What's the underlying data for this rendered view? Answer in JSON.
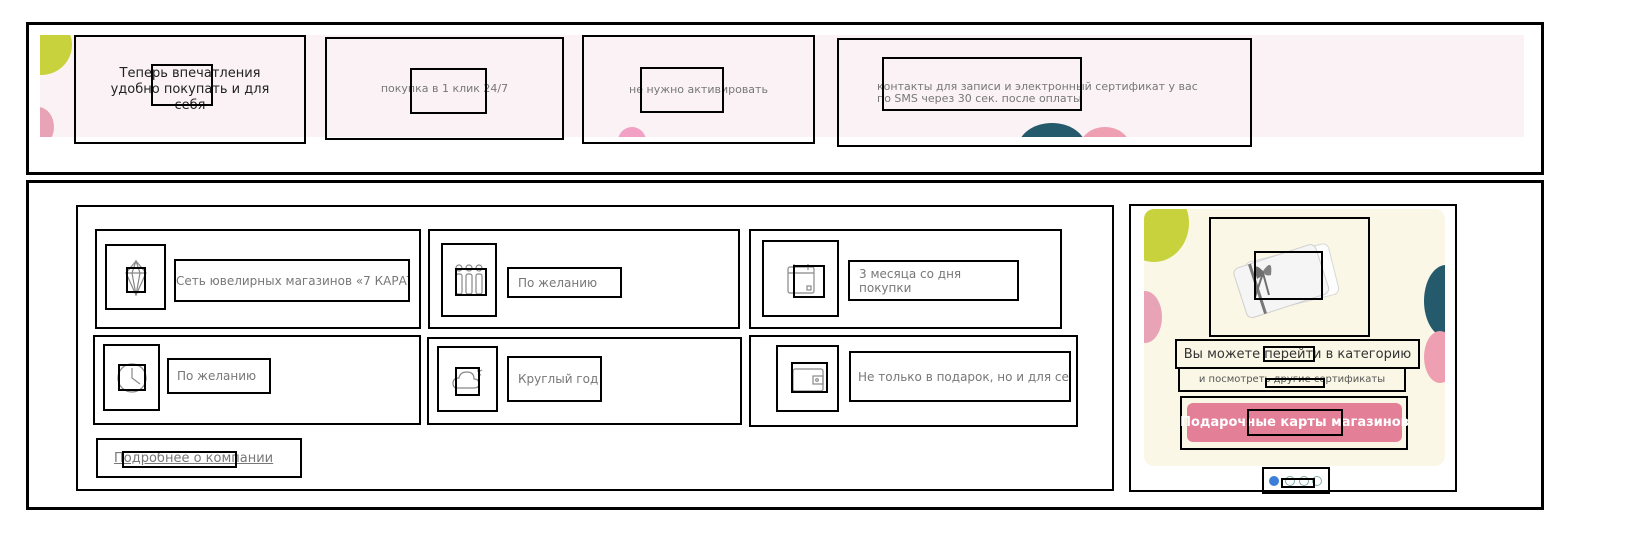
{
  "banner": {
    "title": "Теперь впечатления удобно покупать и для себя",
    "feature_1": "покупка в 1 клик 24/7",
    "feature_2": "не нужно активировать",
    "feature_3": "контакты для записи и электронный сертификат у вас по SMS через 30 сек. после оплаты"
  },
  "info": {
    "items": [
      {
        "icon": "diamond-ring-icon",
        "label": "Сеть ювелирных магазинов «7 КАРАТ»"
      },
      {
        "icon": "nominal-values-icon",
        "label": "По желанию"
      },
      {
        "icon": "calendar-icon",
        "label": "3 месяца со дня покупки"
      },
      {
        "icon": "clock-icon",
        "label": "По желанию"
      },
      {
        "icon": "weather-season-icon",
        "label": "Круглый год"
      },
      {
        "icon": "wallet-icon",
        "label": "Не только в подарок, но и для себя"
      }
    ],
    "more_link": "Подробнее о компании"
  },
  "promo": {
    "title": "Вы можете перейти в категорию",
    "subtitle": "и посмотреть другие сертификаты",
    "button": "Подарочные карты магазинов",
    "slides_count": 3,
    "active_slide": 1
  },
  "colors": {
    "banner_bg": "#faf2f4",
    "promo_bg": "#fbf7e6",
    "accent_pink": "#e47f98",
    "accent_green": "#c8d23c",
    "accent_teal": "#245a6b",
    "dot_active": "#3b7fd9"
  }
}
